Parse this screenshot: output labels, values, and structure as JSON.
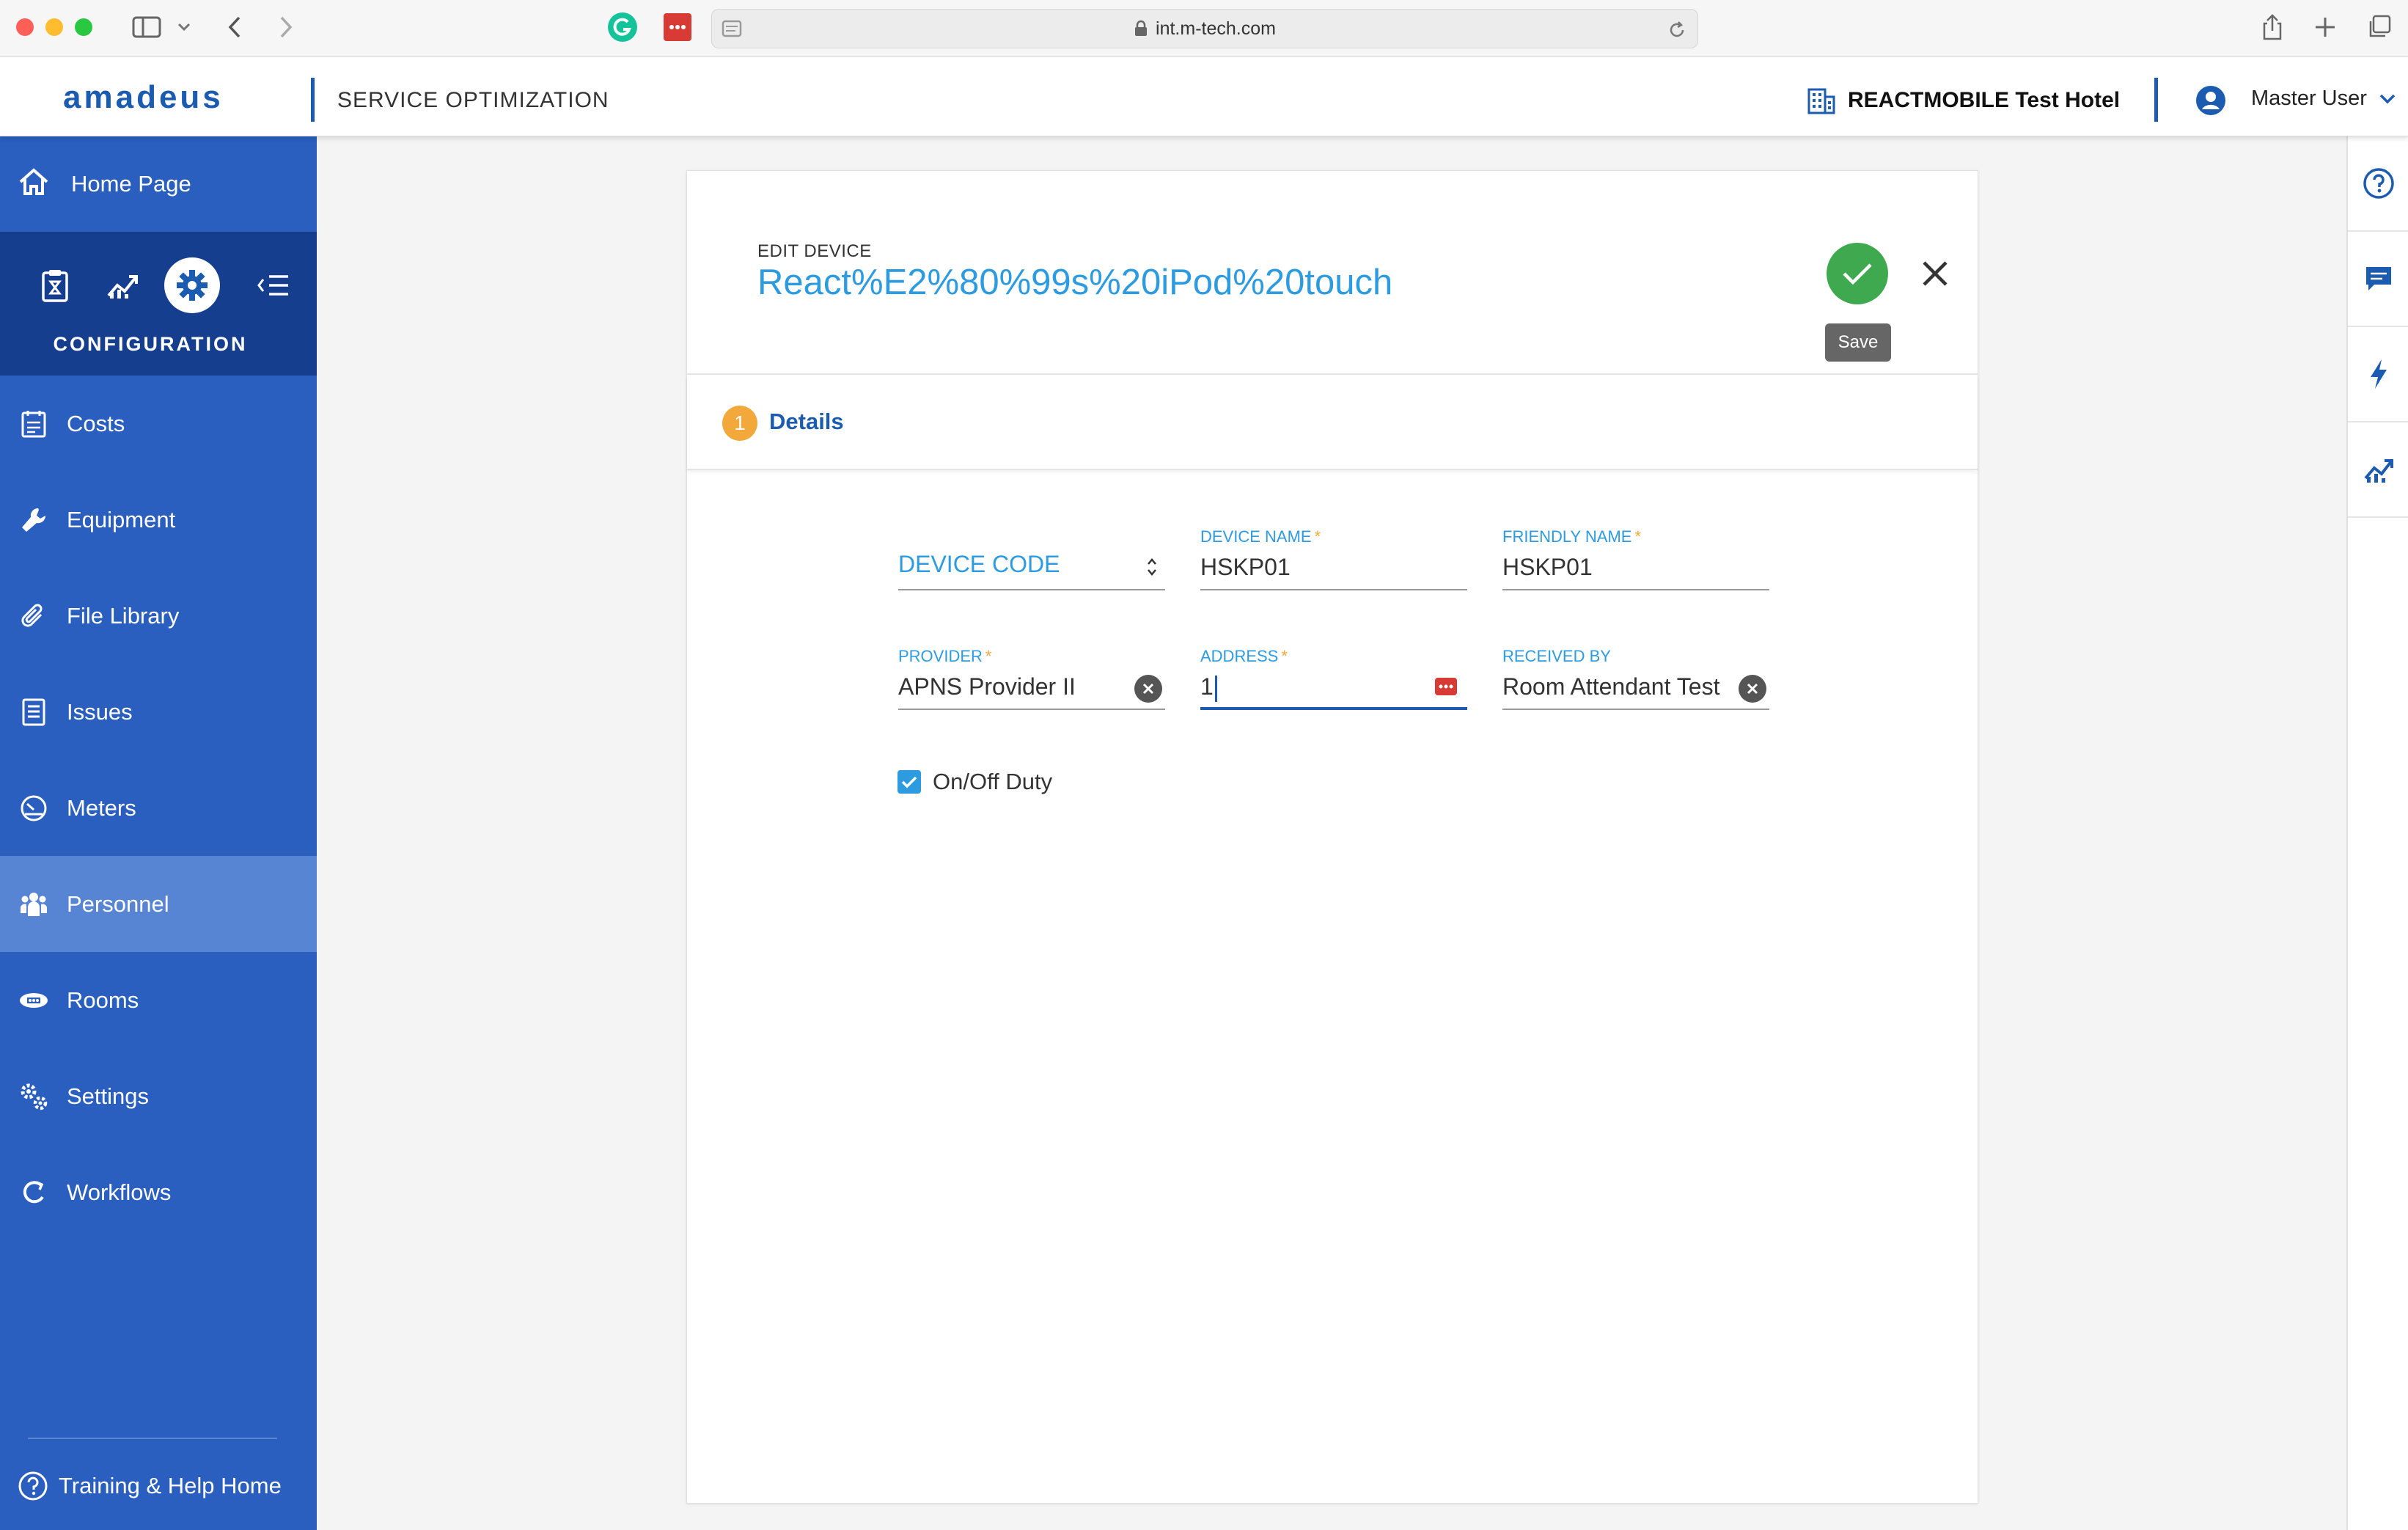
{
  "browser": {
    "url": "int.m-tech.com"
  },
  "header": {
    "logo": "amadeus",
    "app_title": "SERVICE OPTIMIZATION",
    "hotel_name": "REACTMOBILE Test Hotel",
    "user_name": "Master User"
  },
  "sidebar": {
    "home_label": "Home Page",
    "section_title": "CONFIGURATION",
    "items": [
      {
        "label": "Costs",
        "icon": "costs-icon"
      },
      {
        "label": "Equipment",
        "icon": "wrench-icon"
      },
      {
        "label": "File Library",
        "icon": "paperclip-icon"
      },
      {
        "label": "Issues",
        "icon": "issues-icon"
      },
      {
        "label": "Meters",
        "icon": "gauge-icon"
      },
      {
        "label": "Personnel",
        "icon": "people-icon",
        "active": true
      },
      {
        "label": "Rooms",
        "icon": "rooms-icon"
      },
      {
        "label": "Settings",
        "icon": "gears-icon"
      },
      {
        "label": "Workflows",
        "icon": "workflow-icon"
      }
    ],
    "help_label": "Training & Help Home"
  },
  "form": {
    "edit_label": "EDIT DEVICE",
    "device_title": "React%E2%80%99s%20iPod%20touch",
    "save_tooltip": "Save",
    "step_number": "1",
    "step_label": "Details",
    "device_code": {
      "placeholder": "DEVICE CODE"
    },
    "device_name": {
      "label": "DEVICE NAME",
      "required": "*",
      "value": "HSKP01"
    },
    "friendly_name": {
      "label": "FRIENDLY NAME",
      "required": "*",
      "value": "HSKP01"
    },
    "provider": {
      "label": "PROVIDER",
      "required": "*",
      "value": "APNS Provider II"
    },
    "address": {
      "label": "ADDRESS",
      "required": "*",
      "value": "1"
    },
    "received_by": {
      "label": "RECEIVED BY",
      "value": "Room Attendant Test"
    },
    "duty_checkbox": {
      "label": "On/Off Duty",
      "checked": true
    }
  },
  "colors": {
    "brand_blue": "#1b5bb0",
    "sidebar_bg": "#2a5fbf",
    "accent_blue": "#2d9be0",
    "save_green": "#3ea94e",
    "step_orange": "#f3a83b"
  }
}
